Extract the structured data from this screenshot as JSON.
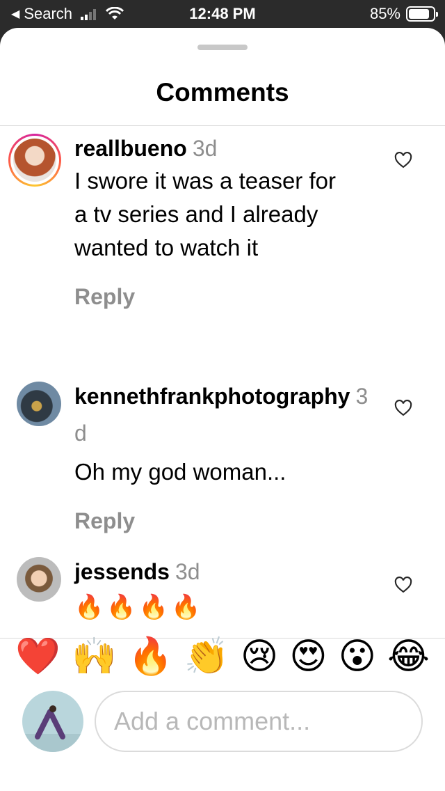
{
  "status_bar": {
    "back_label": "Search",
    "time": "12:48 PM",
    "battery_percent": "85%",
    "battery_level": 0.85
  },
  "sheet": {
    "title": "Comments"
  },
  "comments": [
    {
      "username": "reallbueno",
      "time": "3d",
      "text": "I swore it was a teaser for a tv series and I already wanted to watch it",
      "reply_label": "Reply",
      "has_story_ring": true
    },
    {
      "username": "kennethfrankphotography",
      "time": "3d",
      "text": "Oh my god woman...",
      "reply_label": "Reply",
      "has_story_ring": false
    },
    {
      "username": "jessends",
      "time": "3d",
      "text": "🔥🔥🔥🔥",
      "has_story_ring": false
    }
  ],
  "quick_reactions": [
    "❤️",
    "🙌",
    "🔥",
    "👏",
    "😢",
    "😍",
    "😮",
    "😂"
  ],
  "composer": {
    "placeholder": "Add a comment..."
  },
  "colors": {
    "secondary_text": "#8e8e8e",
    "divider": "#dbdbdb",
    "story_ring_start": "#d6249f",
    "story_ring_end": "#fdc830"
  }
}
